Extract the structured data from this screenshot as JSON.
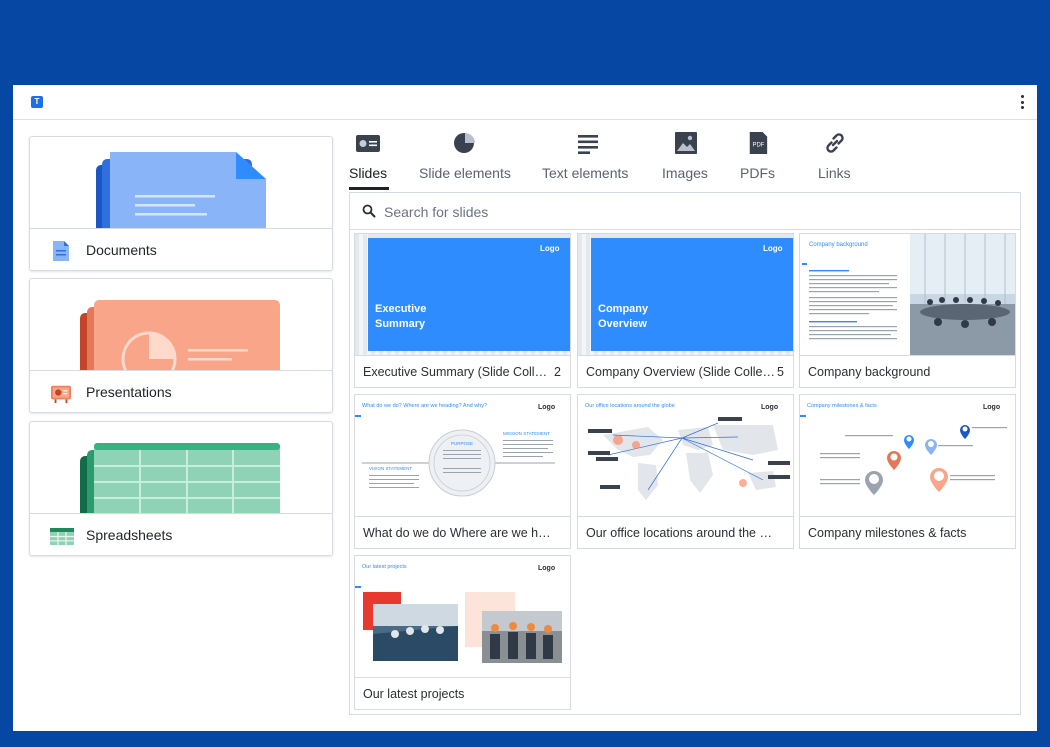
{
  "app": {
    "logo_letter": "T",
    "menu_icon": "kebab-menu-icon"
  },
  "categories": [
    {
      "label": "Documents",
      "icon": "document-icon",
      "color": "#8ab4f8"
    },
    {
      "label": "Presentations",
      "icon": "presentation-icon",
      "color": "#f9a58a"
    },
    {
      "label": "Spreadsheets",
      "icon": "spreadsheet-icon",
      "color": "#8fd3b6"
    }
  ],
  "tabs": [
    {
      "label": "Slides",
      "icon": "slides-icon",
      "active": true
    },
    {
      "label": "Slide elements",
      "icon": "pie-chart-icon"
    },
    {
      "label": "Text elements",
      "icon": "text-lines-icon"
    },
    {
      "label": "Images",
      "icon": "image-icon"
    },
    {
      "label": "PDFs",
      "icon": "pdf-icon",
      "icon_text": "PDF"
    },
    {
      "label": "Links",
      "icon": "link-icon"
    }
  ],
  "search": {
    "placeholder": "Search for slides"
  },
  "slides": [
    {
      "caption": "Executive Summary (Slide Collecti...",
      "count": "2",
      "thumb": {
        "logo": "Logo",
        "title_line1": "Executive",
        "title_line2": "Summary"
      }
    },
    {
      "caption": "Company Overview (Slide Collecti...",
      "count": "5",
      "thumb": {
        "logo": "Logo",
        "title_line1": "Company",
        "title_line2": "Overview"
      }
    },
    {
      "caption": "Company background",
      "thumb": {
        "heading": "Company background"
      }
    },
    {
      "caption": "What do we do Where are we headi...",
      "thumb": {
        "heading": "What do we do? Where are we heading? And why?",
        "logo": "Logo",
        "center": "PURPOSE",
        "right": "MISSION STATEMENT",
        "left": "VISION STATEMENT"
      }
    },
    {
      "caption": "Our office locations around the globe",
      "thumb": {
        "heading": "Our office locations around the globe",
        "logo": "Logo"
      }
    },
    {
      "caption": "Company milestones & facts",
      "thumb": {
        "heading": "Company milestones & facts",
        "logo": "Logo"
      }
    },
    {
      "caption": "Our latest projects",
      "thumb": {
        "heading": "Our latest projects",
        "logo": "Logo"
      }
    }
  ],
  "colors": {
    "accent_blue": "#2f8cff",
    "background": "#0547a2",
    "active_tab": "#1f2328"
  }
}
